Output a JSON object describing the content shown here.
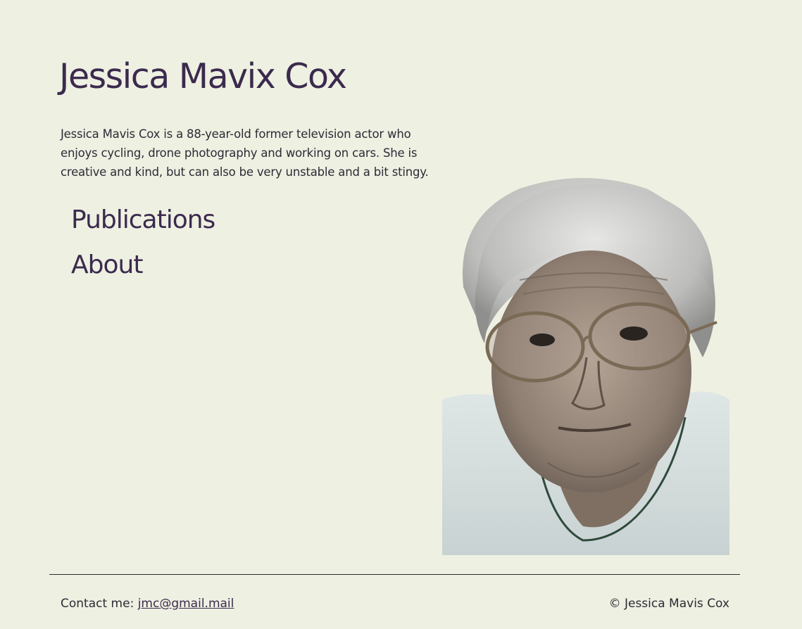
{
  "header": {
    "title": "Jessica Mavix Cox"
  },
  "bio": {
    "text": "Jessica Mavis Cox is a 88-year-old former television actor who enjoys cycling, drone photography and working on cars. She is creative and kind, but can also be very unstable and a bit stingy."
  },
  "nav": {
    "items": [
      {
        "label": "Publications"
      },
      {
        "label": "About"
      }
    ]
  },
  "portrait": {
    "icon": "portrait-photo"
  },
  "footer": {
    "contact_label": "Contact me: ",
    "email": "jmc@gmail.mail",
    "copyright": "© Jessica Mavis Cox"
  },
  "colors": {
    "background": "#eef0e2",
    "heading": "#3b2a4d",
    "text": "#2e2a35"
  }
}
